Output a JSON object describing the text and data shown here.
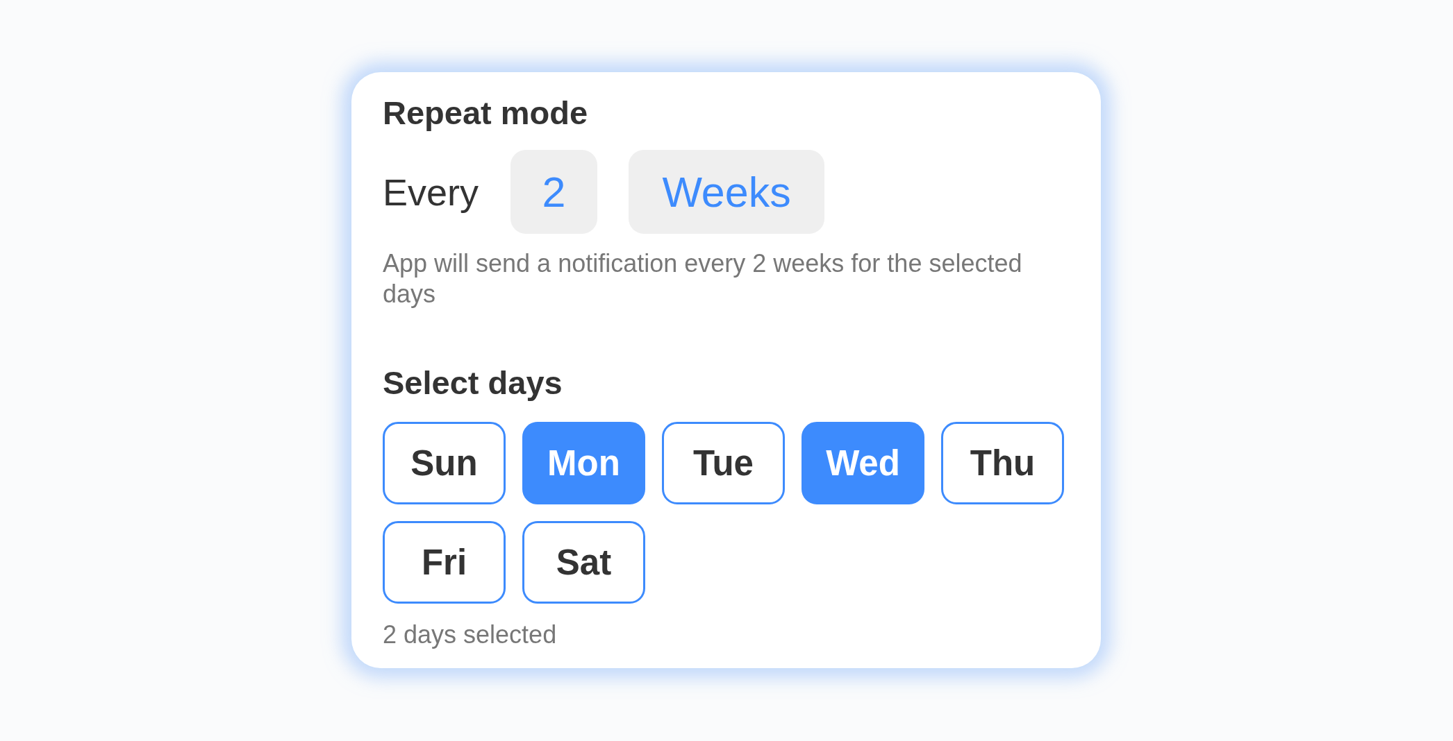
{
  "repeat": {
    "title": "Repeat mode",
    "label": "Every",
    "count": "2",
    "unit": "Weeks",
    "hint": "App will send a notification every 2 weeks for the selected days"
  },
  "days_section": {
    "title": "Select days",
    "days": [
      {
        "label": "Sun",
        "selected": false
      },
      {
        "label": "Mon",
        "selected": true
      },
      {
        "label": "Tue",
        "selected": false
      },
      {
        "label": "Wed",
        "selected": true
      },
      {
        "label": "Thu",
        "selected": false
      },
      {
        "label": "Fri",
        "selected": false
      },
      {
        "label": "Sat",
        "selected": false
      }
    ],
    "summary": "2 days selected"
  }
}
